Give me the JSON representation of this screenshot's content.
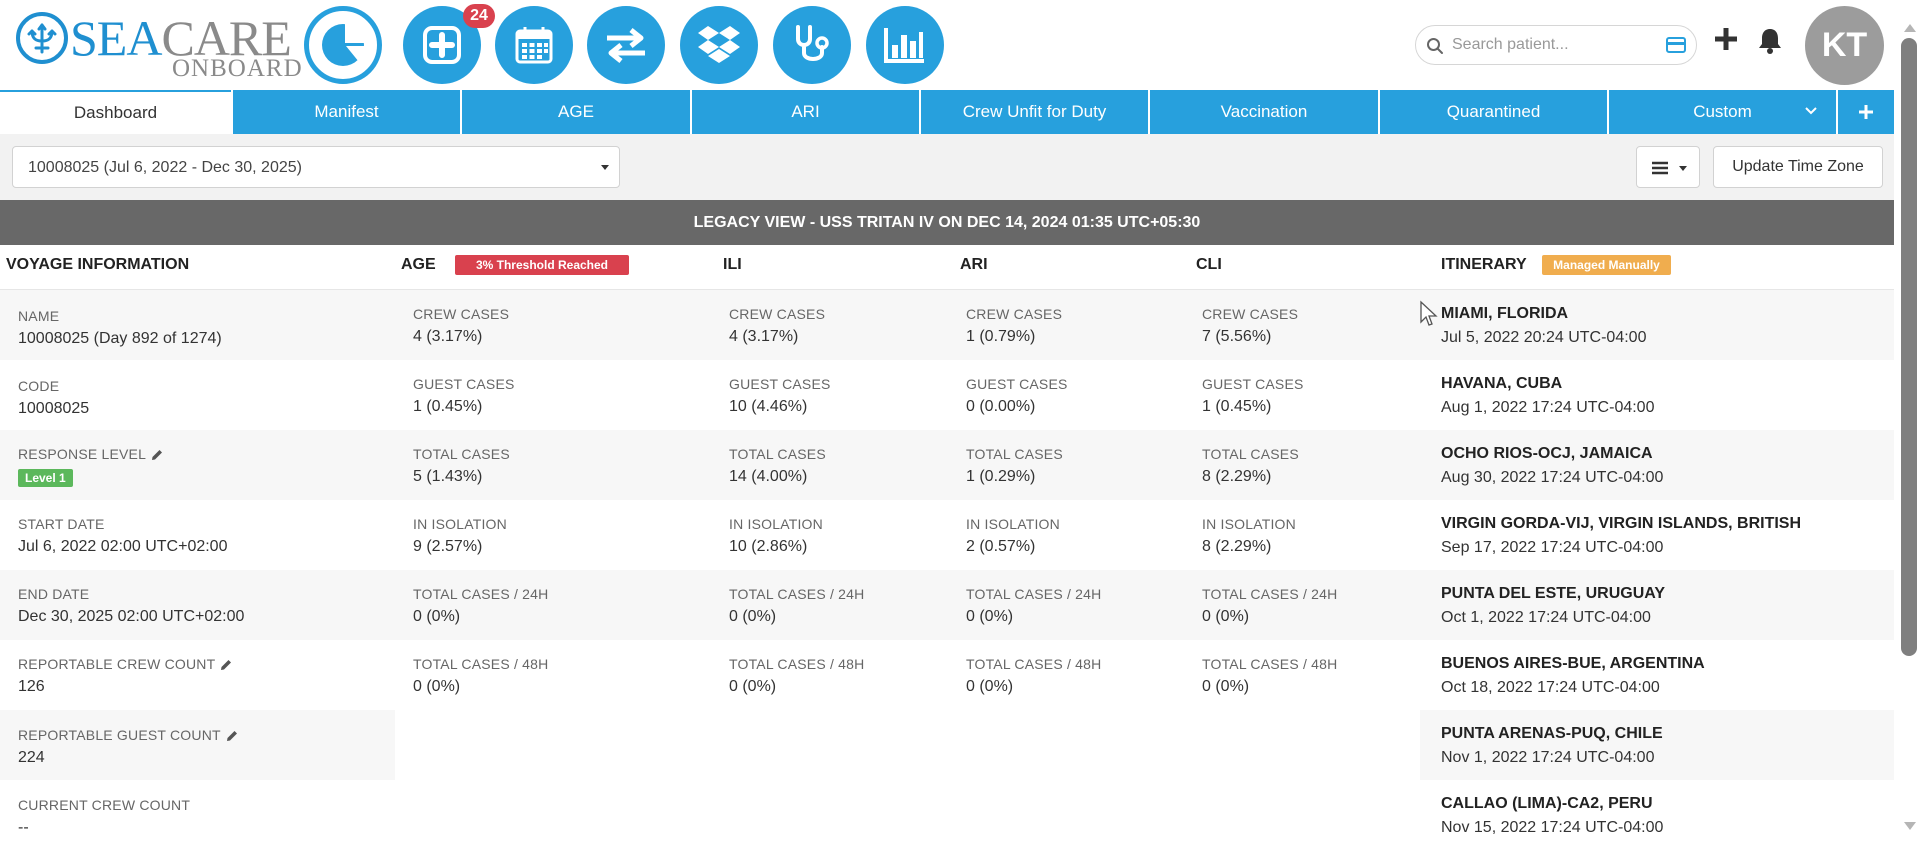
{
  "logo": {
    "sea": "SEA",
    "care": "CARE",
    "onboard": "ONBOARD"
  },
  "nav_icons": [
    {
      "name": "dashboard-pie-icon"
    },
    {
      "name": "medical-plus-icon",
      "badge": "24"
    },
    {
      "name": "calendar-icon"
    },
    {
      "name": "transfer-arrows-icon"
    },
    {
      "name": "dropbox-icon"
    },
    {
      "name": "stethoscope-icon"
    },
    {
      "name": "bar-chart-icon"
    }
  ],
  "search": {
    "placeholder": "Search patient..."
  },
  "user": {
    "initials": "KT"
  },
  "tabs": [
    "Dashboard",
    "Manifest",
    "AGE",
    "ARI",
    "Crew Unfit for Duty",
    "Vaccination",
    "Quarantined",
    "Custom"
  ],
  "voyage_select": {
    "value": "10008025 (Jul 6, 2022 - Dec 30, 2025)"
  },
  "update_tz_label": "Update Time Zone",
  "legacy_banner": "LEGACY VIEW - USS TRITAN IV ON DEC 14, 2024 01:35 UTC+05:30",
  "headers": {
    "voyage": "VOYAGE INFORMATION",
    "age": "AGE",
    "age_tag": "3% Threshold Reached",
    "ili": "ILI",
    "ari": "ARI",
    "cli": "CLI",
    "itinerary": "ITINERARY",
    "itinerary_tag": "Managed Manually"
  },
  "voyage": {
    "name_label": "NAME",
    "name_value": "10008025 (Day 892 of 1274)",
    "code_label": "CODE",
    "code_value": "10008025",
    "response_label": "RESPONSE LEVEL",
    "response_value": "Level 1",
    "start_label": "START DATE",
    "start_value": "Jul 6, 2022 02:00 UTC+02:00",
    "end_label": "END DATE",
    "end_value": "Dec 30, 2025 02:00 UTC+02:00",
    "crew_count_label": "REPORTABLE CREW COUNT",
    "crew_count_value": "126",
    "guest_count_label": "REPORTABLE GUEST COUNT",
    "guest_count_value": "224",
    "current_crew_label": "CURRENT CREW COUNT",
    "current_crew_value": "--"
  },
  "metric_labels": [
    "CREW CASES",
    "GUEST CASES",
    "TOTAL CASES",
    "IN ISOLATION",
    "TOTAL CASES / 24H",
    "TOTAL CASES / 48H"
  ],
  "age": [
    "4 (3.17%)",
    "1 (0.45%)",
    "5 (1.43%)",
    "9 (2.57%)",
    "0 (0%)",
    "0 (0%)"
  ],
  "ili": [
    "4 (3.17%)",
    "10 (4.46%)",
    "14 (4.00%)",
    "10 (2.86%)",
    "0 (0%)",
    "0 (0%)"
  ],
  "ari": [
    "1 (0.79%)",
    "0 (0.00%)",
    "1 (0.29%)",
    "2 (0.57%)",
    "0 (0%)",
    "0 (0%)"
  ],
  "cli": [
    "7 (5.56%)",
    "1 (0.45%)",
    "8 (2.29%)",
    "8 (2.29%)",
    "0 (0%)",
    "0 (0%)"
  ],
  "itinerary": [
    {
      "port": "MIAMI, FLORIDA",
      "date": "Jul 5, 2022 20:24 UTC-04:00"
    },
    {
      "port": "HAVANA, CUBA",
      "date": "Aug 1, 2022 17:24 UTC-04:00"
    },
    {
      "port": "OCHO RIOS-OCJ, JAMAICA",
      "date": "Aug 30, 2022 17:24 UTC-04:00"
    },
    {
      "port": "VIRGIN GORDA-VIJ, VIRGIN ISLANDS, BRITISH",
      "date": "Sep 17, 2022 17:24 UTC-04:00"
    },
    {
      "port": "PUNTA DEL ESTE, URUGUAY",
      "date": "Oct 1, 2022 17:24 UTC-04:00"
    },
    {
      "port": "BUENOS AIRES-BUE, ARGENTINA",
      "date": "Oct 18, 2022 17:24 UTC-04:00"
    },
    {
      "port": "PUNTA ARENAS-PUQ, CHILE",
      "date": "Nov 1, 2022 17:24 UTC-04:00"
    },
    {
      "port": "CALLAO (LIMA)-CA2, PERU",
      "date": "Nov 15, 2022 17:24 UTC-04:00"
    }
  ],
  "colors": {
    "brand_blue": "#27a0dd",
    "logo_blue": "#1f8fd0",
    "alert_red": "#d9414e",
    "warning_orange": "#f0ad4e",
    "level_green": "#5cb85c",
    "banner_gray": "#686868"
  }
}
